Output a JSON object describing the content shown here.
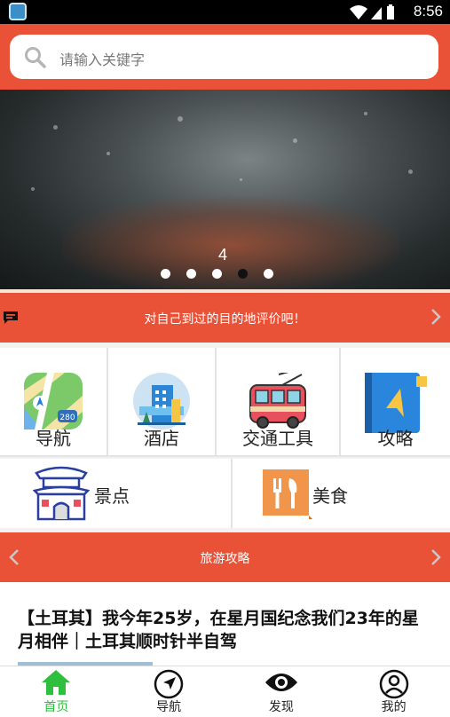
{
  "status_bar": {
    "time": "8:56"
  },
  "search": {
    "placeholder": "请输入关键字"
  },
  "banner": {
    "slide_number": "4",
    "dot_count": 5,
    "active_dot": 3
  },
  "notice": {
    "text": "对自己到过的目的地评价吧！"
  },
  "categories_row1": [
    {
      "label": "导航",
      "icon": "maps-icon"
    },
    {
      "label": "酒店",
      "icon": "hotel-building-icon"
    },
    {
      "label": "交通工具",
      "icon": "trolleybus-icon"
    },
    {
      "label": "攻略",
      "icon": "guide-book-icon"
    }
  ],
  "categories_row2": [
    {
      "label": "景点",
      "icon": "gate-tower-icon"
    },
    {
      "label": "美食",
      "icon": "food-cutlery-icon"
    }
  ],
  "section": {
    "title": "旅游攻略"
  },
  "article": {
    "title": "【土耳其】我今年25岁，在星月国纪念我们23年的星月相伴｜土耳其顺时针半自驾"
  },
  "tabs": [
    {
      "label": "首页",
      "icon": "home-icon",
      "active": true
    },
    {
      "label": "导航",
      "icon": "navigation-arrow-icon",
      "active": false
    },
    {
      "label": "发现",
      "icon": "eye-icon",
      "active": false
    },
    {
      "label": "我的",
      "icon": "user-profile-icon",
      "active": false
    }
  ],
  "colors": {
    "accent": "#ea5238",
    "active_tab": "#2fbf3f"
  }
}
